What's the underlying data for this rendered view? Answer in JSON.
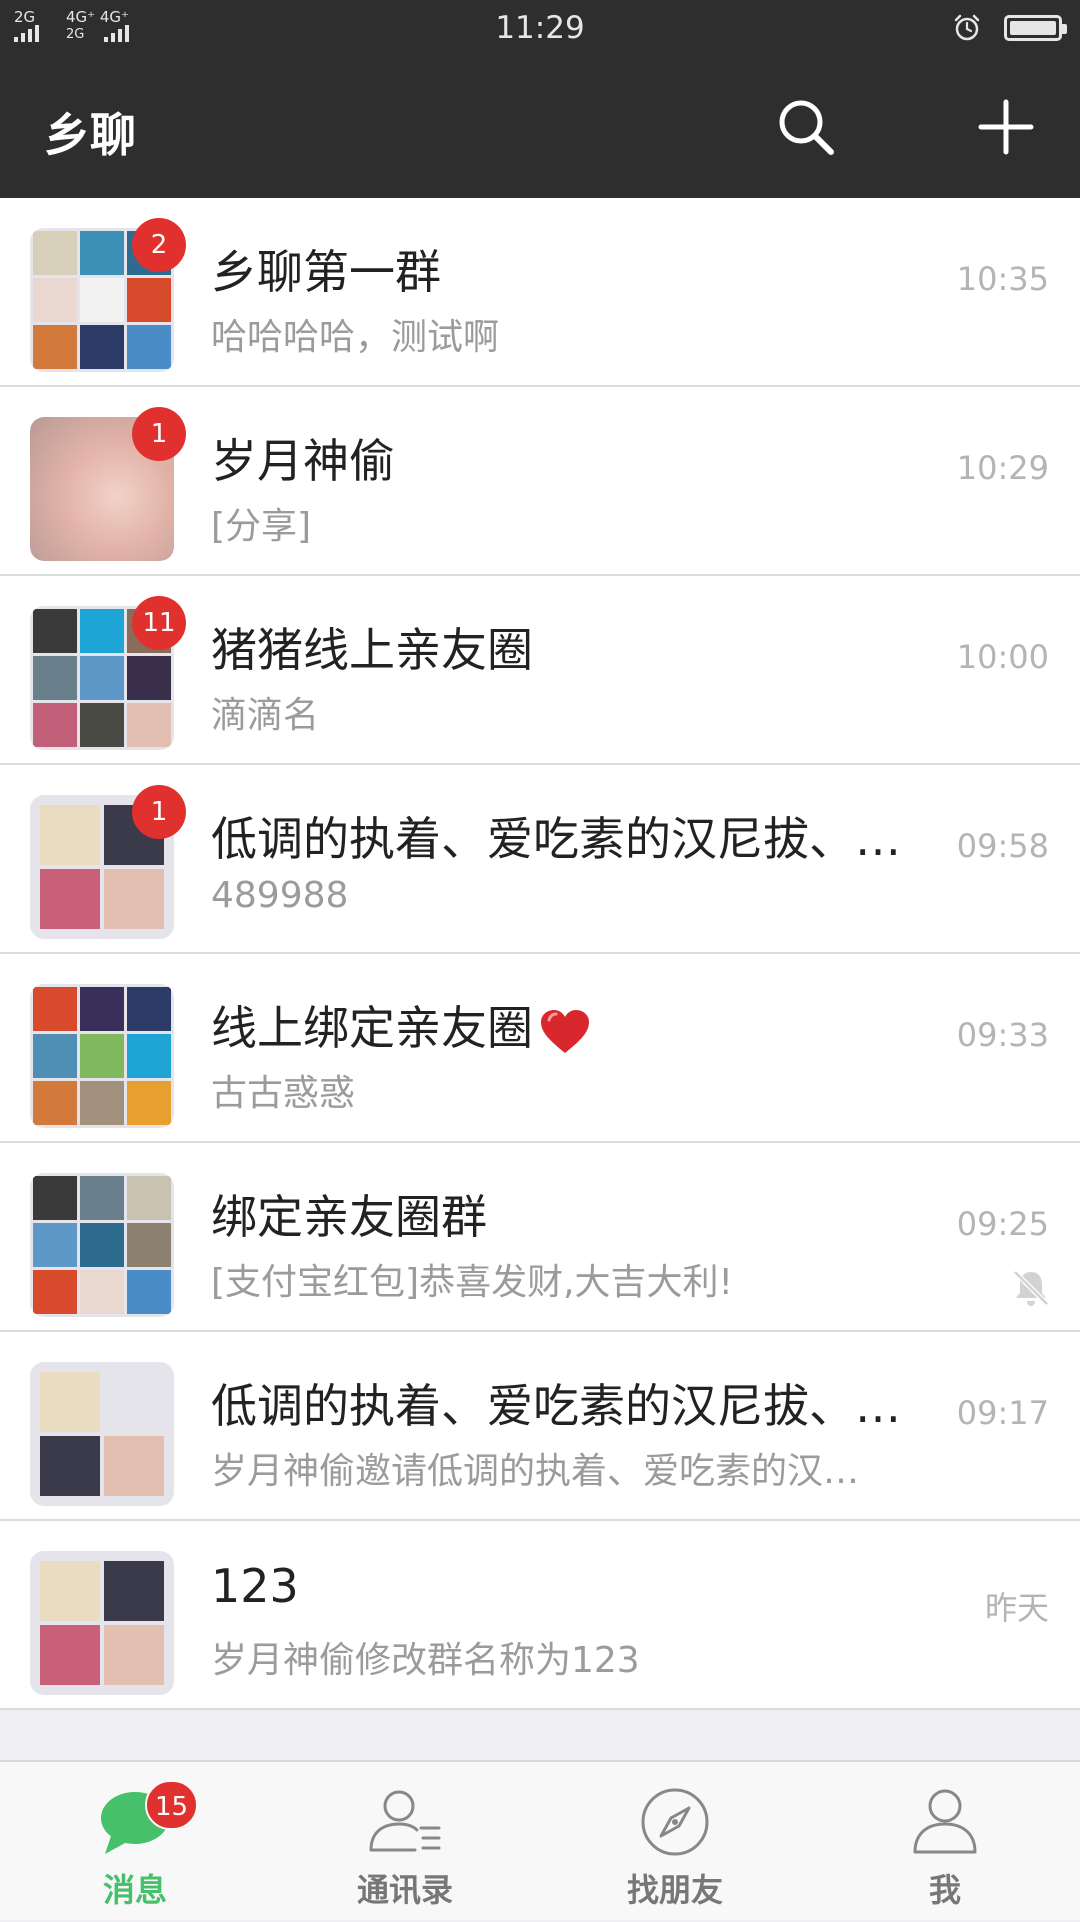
{
  "status_bar": {
    "sim1": "2G",
    "sim2_top": "4G⁺ 4G⁺",
    "sim2_bottom": "2G",
    "time": "11:29",
    "icons": [
      "signal-icon",
      "alarm-icon",
      "battery-icon"
    ]
  },
  "header": {
    "title": "乡聊",
    "icons": [
      "search-icon",
      "plus-icon"
    ]
  },
  "chats": [
    {
      "name": "乡聊第一群",
      "preview": "哈哈哈哈，测试啊",
      "time": "10:35",
      "badge": "2",
      "muted": false
    },
    {
      "name": "岁月神偷",
      "preview": "[分享]",
      "time": "10:29",
      "badge": "1",
      "muted": false
    },
    {
      "name": "猪猪线上亲友圈",
      "preview": "滴滴名",
      "time": "10:00",
      "badge": "11",
      "muted": false
    },
    {
      "name": "低调的执着、爱吃素的汉尼拔、…",
      "preview": "489988",
      "time": "09:58",
      "badge": "1",
      "muted": false
    },
    {
      "name": "线上绑定亲友圈",
      "preview": "古古惑惑",
      "time": "09:33",
      "badge": "",
      "muted": false,
      "emoji": "heart-icon"
    },
    {
      "name": "绑定亲友圈群",
      "preview": "[支付宝红包]恭喜发财,大吉大利!",
      "time": "09:25",
      "badge": "",
      "muted": true
    },
    {
      "name": "低调的执着、爱吃素的汉尼拔、…",
      "preview": "岁月神偷邀请低调的执着、爱吃素的汉…",
      "time": "09:17",
      "badge": "",
      "muted": false
    },
    {
      "name": "123",
      "preview": "岁月神偷修改群名称为123",
      "time": "昨天",
      "badge": "",
      "muted": false
    }
  ],
  "tabs": [
    {
      "label": "消息",
      "icon": "chat-bubble-icon",
      "badge": "15",
      "active": true
    },
    {
      "label": "通讯录",
      "icon": "contacts-icon",
      "active": false
    },
    {
      "label": "找朋友",
      "icon": "compass-icon",
      "active": false
    },
    {
      "label": "我",
      "icon": "person-icon",
      "active": false
    }
  ],
  "colors": {
    "bar_bg": "#2e2e2e",
    "badge_red": "#e0312f",
    "active_green": "#46c06a",
    "list_bg": "#ffffff",
    "page_bg": "#efeff4"
  }
}
